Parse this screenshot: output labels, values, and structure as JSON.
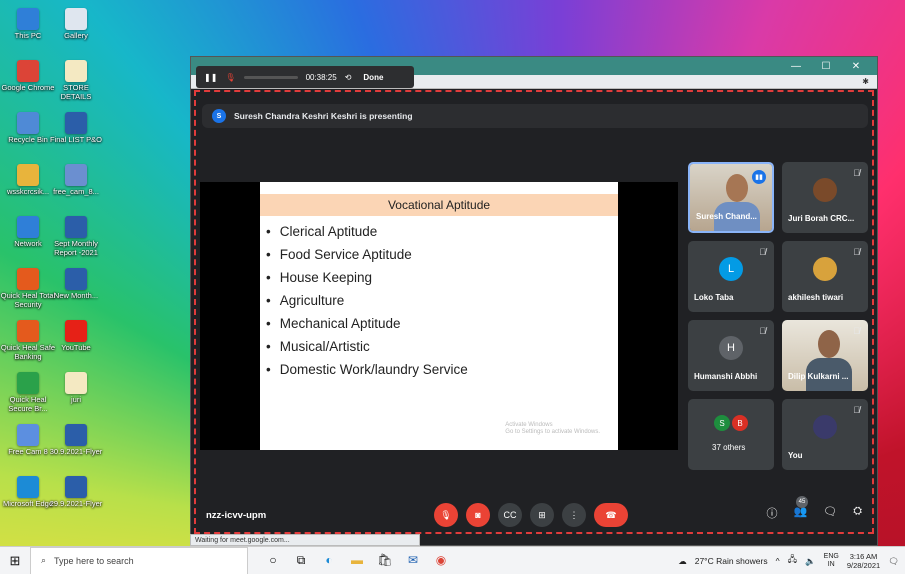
{
  "desktop": {
    "col1": [
      {
        "label": "This PC",
        "icon": "computer-icon",
        "color": "#2f7fd8"
      },
      {
        "label": "Google Chrome",
        "icon": "chrome-icon",
        "color": "#dc4437"
      },
      {
        "label": "Recycle Bin",
        "icon": "recycle-bin-icon",
        "color": "#4f8ad6"
      },
      {
        "label": "wsskcrcsik...",
        "icon": "folder-icon",
        "color": "#e8b43c"
      },
      {
        "label": "Network",
        "icon": "network-icon",
        "color": "#2f7fd8"
      },
      {
        "label": "Quick Heal Total Security",
        "icon": "quick-heal-icon",
        "color": "#e45a1d"
      },
      {
        "label": "Quick Heal Safe Banking",
        "icon": "safe-banking-icon",
        "color": "#e45a1d"
      },
      {
        "label": "Quick Heal Secure Br...",
        "icon": "secure-browser-icon",
        "color": "#2aa14a"
      },
      {
        "label": "Free Cam 8",
        "icon": "free-cam-icon",
        "color": "#5c8fe0"
      },
      {
        "label": "Microsoft Edge",
        "icon": "edge-icon",
        "color": "#1c8bd6"
      }
    ],
    "col2": [
      {
        "label": "Gallery",
        "icon": "document-icon",
        "color": "#dfe6ef"
      },
      {
        "label": "STORE DETAILS",
        "icon": "document-icon",
        "color": "#f4e9c2"
      },
      {
        "label": "Final LIST P&O",
        "icon": "word-doc-icon",
        "color": "#2b5ea9"
      },
      {
        "label": "free_cam_8...",
        "icon": "installer-icon",
        "color": "#6b8fd0"
      },
      {
        "label": "Sept Monthly Report -2021",
        "icon": "word-doc-icon",
        "color": "#2b5ea9"
      },
      {
        "label": "New Month...",
        "icon": "word-doc-icon",
        "color": "#2b5ea9"
      },
      {
        "label": "YouTube",
        "icon": "youtube-icon",
        "color": "#e62117"
      },
      {
        "label": "juri",
        "icon": "document-icon",
        "color": "#f4e9c2"
      },
      {
        "label": "30.9.2021-Flyer",
        "icon": "word-doc-icon",
        "color": "#2b5ea9"
      },
      {
        "label": "29.9.2021-Flyer",
        "icon": "word-doc-icon",
        "color": "#2b5ea9"
      }
    ]
  },
  "recorder": {
    "time": "00:38:25",
    "done_label": "Done"
  },
  "meet": {
    "presenting_initial": "S",
    "presenting_text": "Suresh Chandra Keshri Keshri is presenting",
    "meeting_code": "nzz-icvv-upm",
    "people_count": "45",
    "slide": {
      "title": "Vocational Aptitude",
      "items": [
        "Clerical Aptitude",
        "Food Service Aptitude",
        "House Keeping",
        "Agriculture",
        "Mechanical Aptitude",
        "Musical/Artistic",
        "Domestic Work/laundry Service"
      ],
      "watermark_1": "Activate Windows",
      "watermark_2": "Go to Settings to activate Windows."
    },
    "tiles": [
      {
        "name": "Suresh Chand...",
        "type": "video"
      },
      {
        "name": "Juri Borah CRC...",
        "type": "avatar-photo"
      },
      {
        "name": "Loko Taba",
        "initial": "L",
        "color": "#039be5"
      },
      {
        "name": "akhilesh tiwari",
        "type": "avatar-photo"
      },
      {
        "name": "Humanshi Abbhi",
        "initial": "H",
        "color": "#5f6368"
      },
      {
        "name": "Dilip Kulkarni ...",
        "type": "video"
      },
      {
        "name": "37 others",
        "initials": [
          "S",
          "B"
        ]
      },
      {
        "name": "You",
        "type": "avatar-photo"
      }
    ]
  },
  "browser": {
    "status": "Waiting for meet.google.com..."
  },
  "taskbar": {
    "search_placeholder": "Type here to search",
    "weather": "27°C  Rain showers",
    "lang_1": "ENG",
    "lang_2": "IN",
    "time": "3:16 AM",
    "date": "9/28/2021"
  }
}
